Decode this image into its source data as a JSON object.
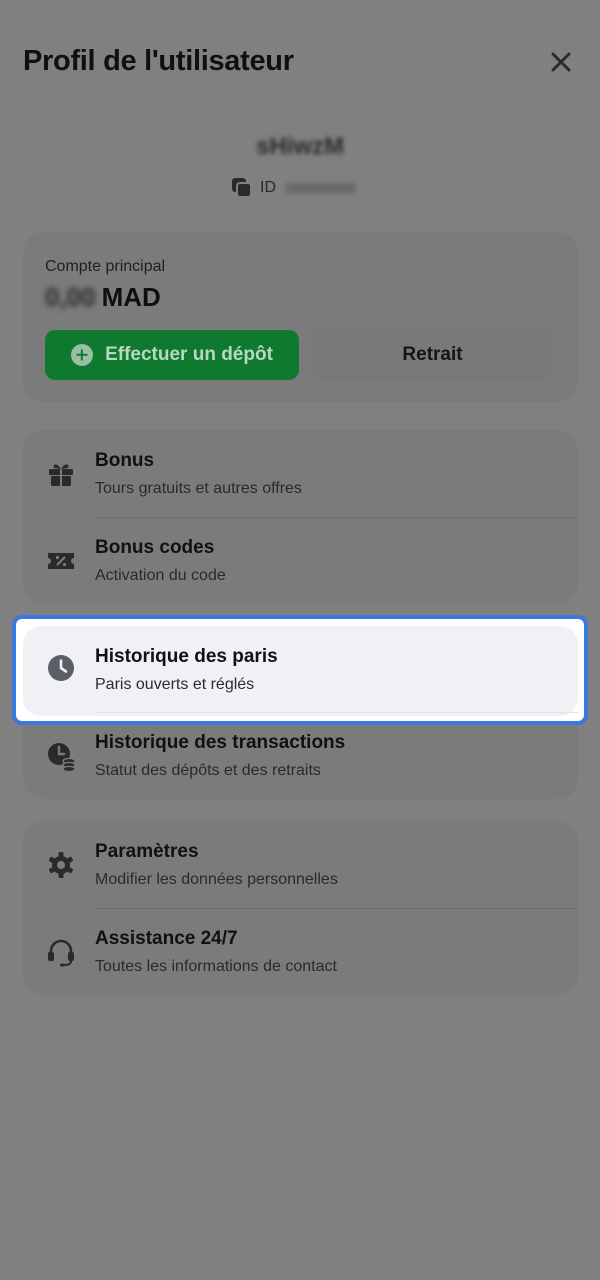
{
  "header": {
    "title": "Profil de l'utilisateur",
    "close_icon": "close-icon"
  },
  "user": {
    "name": "sHiwzM",
    "id_label": "ID",
    "id_value": "000000000"
  },
  "account": {
    "label": "Compte principal",
    "balance": "0,00",
    "currency": "MAD",
    "deposit_label": "Effectuer un dépôt",
    "withdraw_label": "Retrait"
  },
  "menu": {
    "bonus": {
      "title": "Bonus",
      "subtitle": "Tours gratuits et autres offres",
      "icon": "gift-icon"
    },
    "bonus_codes": {
      "title": "Bonus codes",
      "subtitle": "Activation du code",
      "icon": "ticket-percent-icon"
    },
    "bets_history": {
      "title": "Historique des paris",
      "subtitle": "Paris ouverts et réglés",
      "icon": "clock-icon"
    },
    "transactions_history": {
      "title": "Historique des transactions",
      "subtitle": "Statut des dépôts et des retraits",
      "icon": "clock-coins-icon"
    },
    "settings": {
      "title": "Paramètres",
      "subtitle": "Modifier les données personnelles",
      "icon": "gear-icon"
    },
    "support": {
      "title": "Assistance 24/7",
      "subtitle": "Toutes les informations de contact",
      "icon": "headset-icon"
    }
  },
  "colors": {
    "overlay": "#808080",
    "highlight_border": "#3a78e0",
    "deposit_green": "#0f7a2f"
  }
}
